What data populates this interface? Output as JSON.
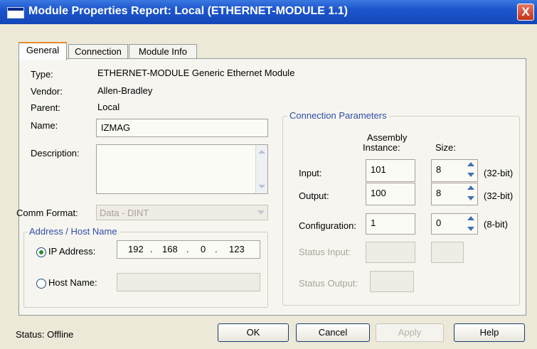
{
  "window": {
    "title": "Module Properties Report: Local (ETHERNET-MODULE 1.1)",
    "close": "X"
  },
  "tabs": [
    "General",
    "Connection",
    "Module Info"
  ],
  "general": {
    "type_label": "Type:",
    "type_value": "ETHERNET-MODULE Generic Ethernet Module",
    "vendor_label": "Vendor:",
    "vendor_value": "Allen-Bradley",
    "parent_label": "Parent:",
    "parent_value": "Local",
    "name_label": "Name:",
    "name_value": "IZMAG",
    "description_label": "Description:",
    "description_value": "",
    "comm_format_label": "Comm Format:",
    "comm_format_value": "Data - DINT",
    "address_group_label": "Address / Host Name",
    "ip_label": "IP Address:",
    "ip_octets": [
      "192",
      "168",
      "0",
      "123"
    ],
    "ip_dot": ".",
    "host_label": "Host Name:",
    "host_value": ""
  },
  "connection_parameters": {
    "title": "Connection Parameters",
    "assembly_header_line1": "Assembly",
    "assembly_header_line2": "Instance:",
    "size_header": "Size:",
    "rows": [
      {
        "label": "Input:",
        "instance": "101",
        "size": "8",
        "unit": "(32-bit)"
      },
      {
        "label": "Output:",
        "instance": "100",
        "size": "8",
        "unit": "(32-bit)"
      },
      {
        "label": "Configuration:",
        "instance": "1",
        "size": "0",
        "unit": "(8-bit)"
      }
    ],
    "status_input_label": "Status Input:",
    "status_output_label": "Status Output:"
  },
  "footer": {
    "status": "Status:  Offline",
    "ok": "OK",
    "cancel": "Cancel",
    "apply": "Apply",
    "help": "Help"
  }
}
